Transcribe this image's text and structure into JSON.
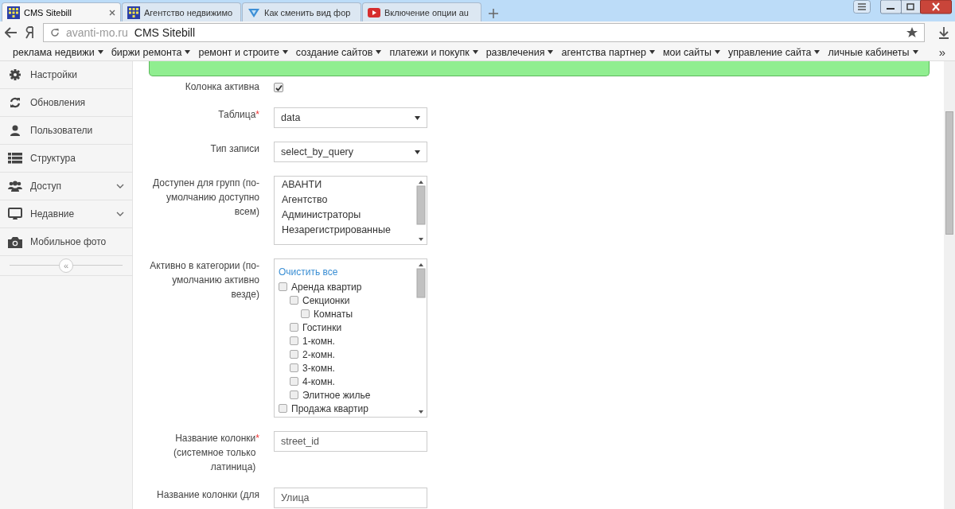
{
  "browser": {
    "tabs": [
      {
        "title": "CMS Sitebill",
        "selected": true
      },
      {
        "title": "Агентство недвижимо",
        "selected": false
      },
      {
        "title": "Как сменить вид фор",
        "selected": false
      },
      {
        "title": "Включение опции au",
        "selected": false
      }
    ],
    "address": {
      "host": "avanti-mo.ru",
      "title": "CMS Sitebill"
    },
    "bookmarks": [
      "реклама недвижи",
      "биржи ремонта",
      "ремонт и строите",
      "создание сайтов",
      "платежи и покупк",
      "развлечения",
      "агентства партнер",
      "мои сайты",
      "управление сайта",
      "личные кабинеты"
    ],
    "bookmarks_more": "»"
  },
  "sidebar": {
    "items": [
      {
        "label": "Настройки",
        "expandable": false
      },
      {
        "label": "Обновления",
        "expandable": false
      },
      {
        "label": "Пользователи",
        "expandable": false
      },
      {
        "label": "Структура",
        "expandable": false
      },
      {
        "label": "Доступ",
        "expandable": true
      },
      {
        "label": "Недавние",
        "expandable": true
      },
      {
        "label": "Мобильное фото",
        "expandable": false
      }
    ],
    "collapse": "«"
  },
  "form": {
    "rows": [
      {
        "kind": "checkbox",
        "label": "Колонка активна",
        "checked": true
      },
      {
        "kind": "select",
        "label": "Таблица",
        "required_mark": "*",
        "value": "data"
      },
      {
        "kind": "select",
        "label": "Тип записи",
        "value": "select_by_query"
      },
      {
        "kind": "listbox",
        "label": "Доступен для групп (по-умолчанию доступно всем)",
        "options": [
          "АВАНТИ",
          "Агентство",
          "Администраторы",
          "Незарегистрированные"
        ]
      },
      {
        "kind": "tree",
        "label": "Активно в категории (по-умолчанию активно везде)",
        "clear_link": "Очистить все",
        "items": [
          {
            "label": "Аренда квартир",
            "checked": false,
            "children": [
              {
                "label": "Секционки",
                "checked": false,
                "children": [
                  {
                    "label": "Комнаты",
                    "checked": false
                  }
                ]
              },
              {
                "label": "Гостинки",
                "checked": false
              },
              {
                "label": "1-комн.",
                "checked": false
              },
              {
                "label": "2-комн.",
                "checked": false
              },
              {
                "label": "3-комн.",
                "checked": false
              },
              {
                "label": "4-комн.",
                "checked": false
              },
              {
                "label": "Элитное жилье",
                "checked": false
              }
            ]
          },
          {
            "label": "Продажа квартир",
            "checked": false
          }
        ]
      },
      {
        "kind": "input",
        "label": "Название колонки (системное только латиница)",
        "required_mark": "*",
        "value": "street_id"
      },
      {
        "kind": "input",
        "label": "Название колонки (для",
        "value": "Улица"
      }
    ]
  }
}
